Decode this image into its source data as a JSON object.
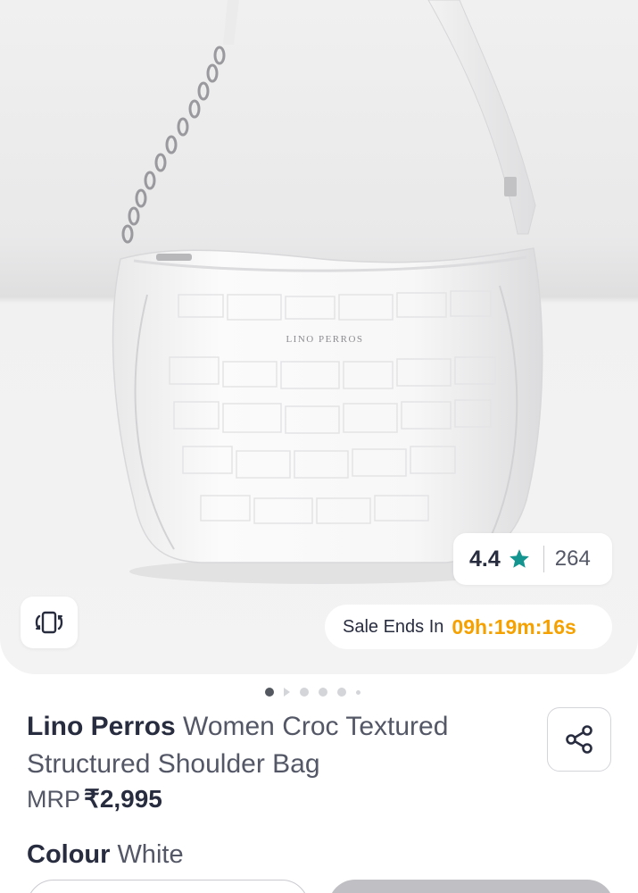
{
  "product": {
    "brand": "Lino Perros",
    "name": "Women Croc Textured Structured Shoulder Bag",
    "mrp_label": "MRP",
    "mrp_value": "₹2,995",
    "colour_label": "Colour",
    "colour_value": "White",
    "logo_text": "LINO PERROS"
  },
  "rating": {
    "value": "4.4",
    "count": "264",
    "star_color": "#14958f",
    "icon": "star-icon"
  },
  "sale": {
    "label": "Sale Ends In",
    "timer": "09h:19m:16s",
    "timer_color": "#f5a100"
  },
  "gallery": {
    "total_images": 6,
    "active_index": 0
  },
  "icons": {
    "ar_view": "rotate-view-icon",
    "share": "share-icon"
  }
}
